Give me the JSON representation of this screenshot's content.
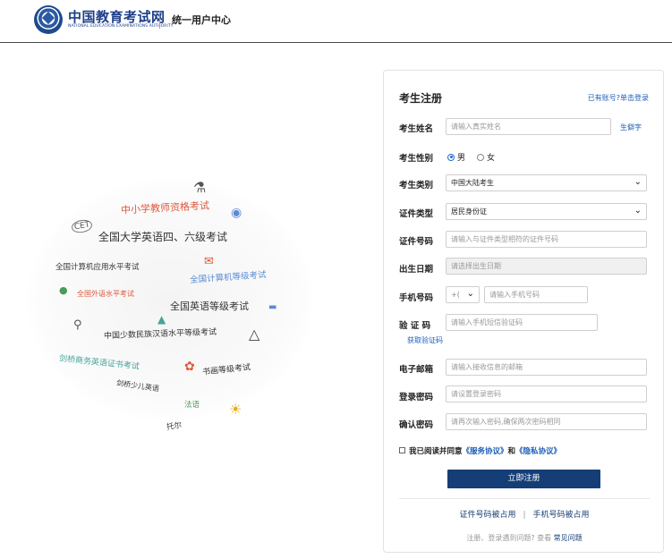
{
  "header": {
    "logo_cn": "中国教育考试网",
    "logo_en": "NATIONAL EDUCATION EXAMINATIONS AUTHORITY",
    "subtitle": "统一用户中心"
  },
  "illustration": {
    "texts": [
      "中小学教师资格考试",
      "全国大学英语四、六级考试",
      "全国计算机应用水平考试",
      "全国计算机等级考试",
      "全国外语水平考试",
      "全国英语等级考试",
      "中国少数民族汉语水平等级考试",
      "剑桥商务英语证书考试",
      "书画等级考试",
      "剑桥少儿英语",
      "法语",
      "托尔"
    ],
    "cet_badge": "CET",
    "colors": {
      "red": "#e0583c",
      "dark": "#333333",
      "blue": "#5b8bd6",
      "green": "#4a9a5a",
      "teal": "#47a39a"
    }
  },
  "form": {
    "title": "考生注册",
    "login_link": "已有账号?单击登录",
    "name": {
      "label": "考生姓名",
      "placeholder": "请输入真实姓名",
      "rare_link": "生僻字"
    },
    "gender": {
      "label": "考生性别",
      "options": [
        "男",
        "女"
      ],
      "selected": "男"
    },
    "category": {
      "label": "考生类别",
      "value": "中国大陆考生"
    },
    "id_type": {
      "label": "证件类型",
      "value": "居民身份证"
    },
    "id_number": {
      "label": "证件号码",
      "placeholder": "请输入与证件类型相符的证件号码"
    },
    "birth": {
      "label": "出生日期",
      "placeholder": "请选择出生日期"
    },
    "phone": {
      "label": "手机号码",
      "prefix": "+(",
      "placeholder": "请输入手机号码"
    },
    "code": {
      "label": "验 证 码",
      "placeholder": "请输入手机短信验证码",
      "get_code": "获取验证码"
    },
    "email": {
      "label": "电子邮箱",
      "placeholder": "请输入接收信息的邮箱"
    },
    "password": {
      "label": "登录密码",
      "placeholder": "请设置登录密码"
    },
    "confirm": {
      "label": "确认密码",
      "placeholder": "请再次输入密码,确保两次密码相同"
    },
    "agreement": {
      "prefix": "我已阅读并同意",
      "service": "《服务协议》",
      "and": "和",
      "privacy": "《隐私协议》"
    },
    "submit": "立即注册",
    "footer_links": [
      "证件号码被占用",
      "手机号码被占用"
    ],
    "help_prefix": "注册、登录遇到问题? 查看",
    "help_link": "常见问题"
  }
}
